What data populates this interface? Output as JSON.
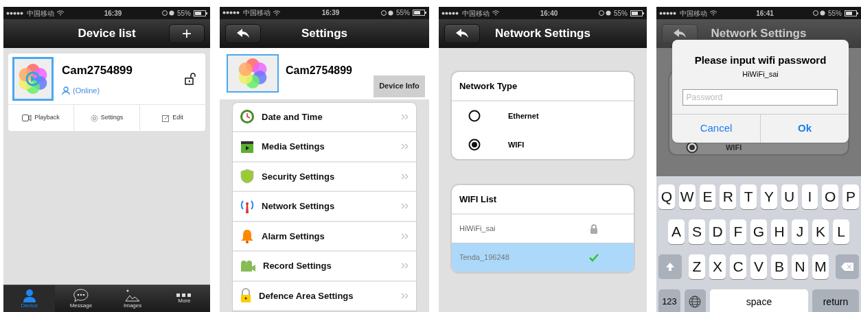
{
  "screens": [
    {
      "kind": "device_list",
      "status": {
        "carrier": "中国移动",
        "time": "16:39",
        "battery": "55%"
      },
      "title": "Device list",
      "add_button": "+",
      "device": {
        "name": "Cam2754899",
        "state": "(Online)"
      },
      "actions": [
        {
          "kind": "playback",
          "label": "Playback"
        },
        {
          "kind": "settings",
          "label": "Settings"
        },
        {
          "kind": "edit",
          "label": "Edit"
        }
      ],
      "tabs": [
        {
          "kind": "person",
          "label": "Device",
          "selected": true
        },
        {
          "kind": "chat",
          "label": "Message",
          "selected": false
        },
        {
          "kind": "image",
          "label": "Images",
          "selected": false
        },
        {
          "kind": "more",
          "label": "More",
          "selected": false
        }
      ]
    },
    {
      "kind": "settings",
      "status": {
        "carrier": "中国移动",
        "time": "16:39",
        "battery": "55%"
      },
      "title": "Settings",
      "device": {
        "name": "Cam2754899"
      },
      "info_button": "Device Info",
      "items": [
        {
          "kind": "clock",
          "label": "Date and Time"
        },
        {
          "kind": "media",
          "label": "Media Settings"
        },
        {
          "kind": "shield",
          "label": "Security Settings"
        },
        {
          "kind": "antenna",
          "label": "Network Settings"
        },
        {
          "kind": "bell",
          "label": "Alarm Settings"
        },
        {
          "kind": "camera",
          "label": "Record Settings"
        },
        {
          "kind": "lock",
          "label": "Defence Area Settings"
        }
      ]
    },
    {
      "kind": "network",
      "status": {
        "carrier": "中国移动",
        "time": "16:40",
        "battery": "55%"
      },
      "title": "Network Settings",
      "type_heading": "Network Type",
      "options": [
        {
          "label": "Ethernet",
          "selected": false
        },
        {
          "label": "WIFI",
          "selected": true
        }
      ],
      "list_heading": "WIFI List",
      "networks": [
        {
          "name": "HiWiFi_sai",
          "locked": true,
          "selected": false
        },
        {
          "name": "Tenda_196248",
          "locked": false,
          "selected": true
        }
      ]
    },
    {
      "kind": "password",
      "status": {
        "carrier": "中国移动",
        "time": "16:41",
        "battery": "55%"
      },
      "title": "Network Settings",
      "option": {
        "label": "WIFI",
        "selected": true
      },
      "dialog": {
        "title": "Please input wifi password",
        "network": "HiWiFi_sai",
        "placeholder": "Password",
        "buttons": [
          "Cancel",
          "Ok"
        ]
      },
      "keyboard": {
        "rows": [
          [
            "Q",
            "W",
            "E",
            "R",
            "T",
            "Y",
            "U",
            "I",
            "O",
            "P"
          ],
          [
            "A",
            "S",
            "D",
            "F",
            "G",
            "H",
            "J",
            "K",
            "L"
          ],
          [
            "Z",
            "X",
            "C",
            "V",
            "B",
            "N",
            "M"
          ]
        ],
        "numbers_key": "123",
        "space_key": "space",
        "return_key": "return"
      }
    }
  ]
}
